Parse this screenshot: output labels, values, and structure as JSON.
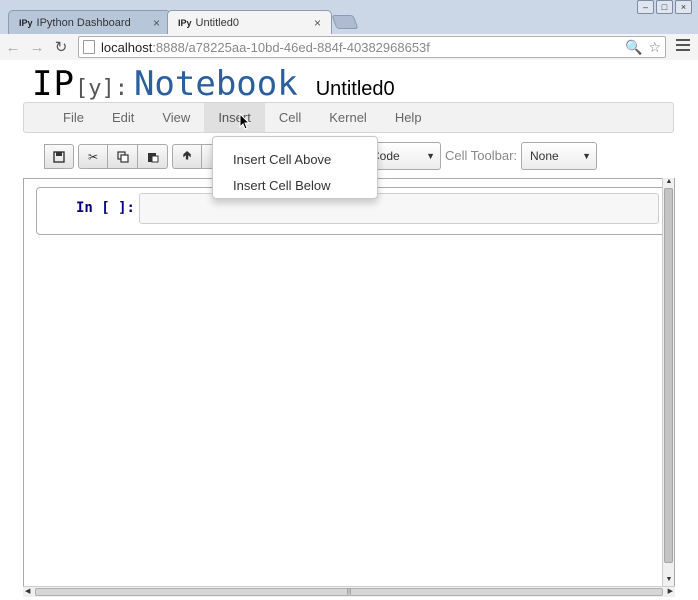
{
  "browser": {
    "tabs": [
      {
        "favicon": "IPy",
        "label": "IPython Dashboard",
        "close": "×"
      },
      {
        "favicon": "IPy",
        "label": "Untitled0",
        "close": "×"
      }
    ],
    "window_buttons": [
      "–",
      "□",
      "×"
    ],
    "url_host": "localhost",
    "url_path": ":8888/a78225aa-10bd-46ed-884f-40382968653f",
    "icons": [
      "back-arrow-icon",
      "forward-arrow-icon",
      "reload-icon",
      "page-icon",
      "zoom-icon",
      "star-icon",
      "menu-icon"
    ]
  },
  "header": {
    "logo_ip": "IP",
    "logo_y": "[y]:",
    "logo_notebook": "Notebook",
    "notebook_name": "Untitled0"
  },
  "menubar": {
    "items": [
      "File",
      "Edit",
      "View",
      "Insert",
      "Cell",
      "Kernel",
      "Help"
    ],
    "open_item": "Insert"
  },
  "insert_menu": {
    "items": [
      "Insert Cell Above",
      "Insert Cell Below"
    ]
  },
  "toolbar": {
    "cell_type_value": "Code",
    "cell_toolbar_label": "Cell Toolbar:",
    "cell_toolbar_value": "None"
  },
  "cell": {
    "prompt": "In [ ]:",
    "content": ""
  }
}
